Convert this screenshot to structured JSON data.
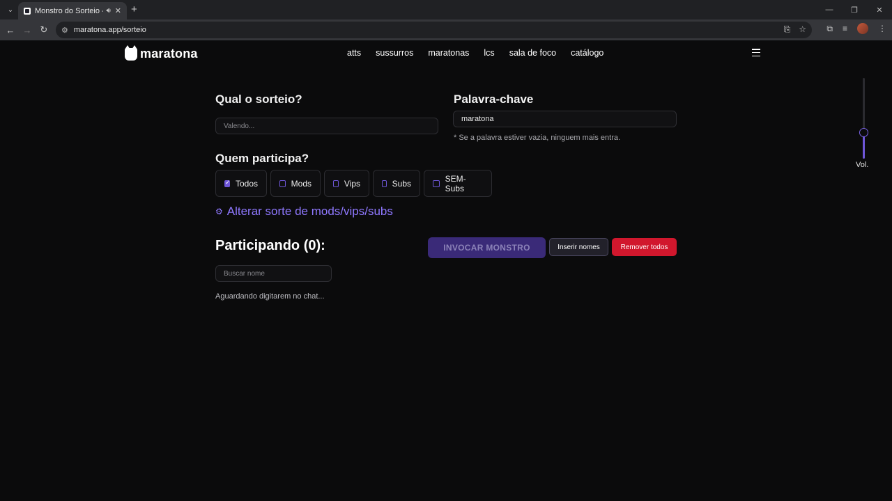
{
  "browser": {
    "tab_title": "Monstro do Sorteio - Twitch",
    "url": "maratona.app/sorteio"
  },
  "site": {
    "logo_text": "maratona",
    "nav": [
      "atts",
      "sussurros",
      "maratonas",
      "lcs",
      "sala de foco",
      "catálogo"
    ]
  },
  "form": {
    "sorteio_label": "Qual o sorteio?",
    "sorteio_placeholder": "Valendo...",
    "keyword_label": "Palavra-chave",
    "keyword_value": "maratona",
    "keyword_note": "* Se a palavra estiver vazia, ninguem mais entra.",
    "participants_label": "Quem participa?",
    "options": [
      {
        "label": "Todos",
        "checked": true
      },
      {
        "label": "Mods",
        "checked": false
      },
      {
        "label": "Vips",
        "checked": false
      },
      {
        "label": "Subs",
        "checked": false
      },
      {
        "label": "SEM-Subs",
        "checked": false
      }
    ],
    "luck_link": "Alterar sorte de mods/vips/subs"
  },
  "participants": {
    "title": "Participando (0):",
    "invoke_button": "INVOCAR MONSTRO",
    "insert_button": "Inserir nomes",
    "remove_button": "Remover todos",
    "search_placeholder": "Buscar nome",
    "waiting_text": "Aguardando digitarem no chat..."
  },
  "volume": {
    "label": "Vol.",
    "level": 0.33
  },
  "colors": {
    "accent": "#6f57d9",
    "danger": "#d1172d",
    "background": "#0b0b0c"
  }
}
